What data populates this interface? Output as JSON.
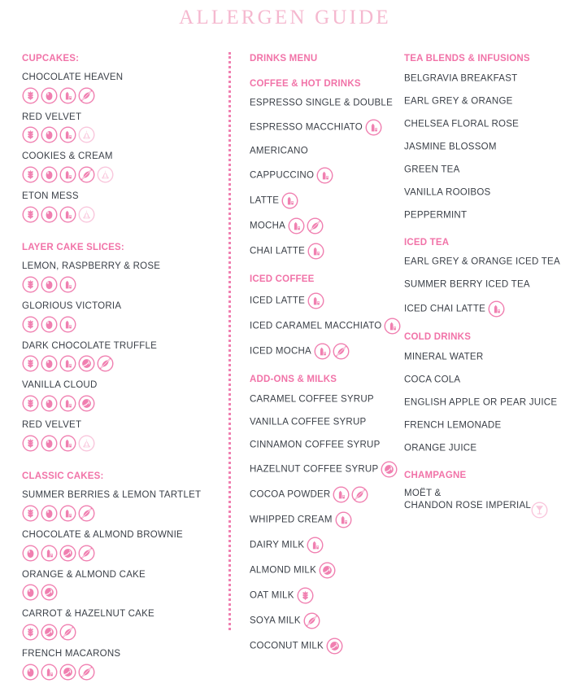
{
  "title": "ALLERGEN GUIDE",
  "colors": {
    "title_pink": "#f5b8cf",
    "heading_pink": "#f173a8",
    "icon_pink": "#f07fb0",
    "icon_pink_light": "#f9c6dc",
    "text_dark": "#3a3f47"
  },
  "icon_legend": {
    "gluten": "wheat-icon",
    "egg": "egg-icon",
    "milk": "milk-icon",
    "nuts": "nut-crossed-icon",
    "soya": "soya-icon",
    "tree_nut": "hazelnut-icon",
    "champagne": "champagne-glass-icon"
  },
  "columns": [
    {
      "id": "bakes",
      "sections": [
        {
          "heading": "CUPCAKES:",
          "layout": "stacked",
          "items": [
            {
              "name": "CHOCOLATE HEAVEN",
              "icons": [
                "gluten",
                "egg",
                "milk",
                "nuts"
              ]
            },
            {
              "name": "RED VELVET",
              "icons": [
                "gluten",
                "egg",
                "milk",
                "soya"
              ]
            },
            {
              "name": "COOKIES & CREAM",
              "icons": [
                "gluten",
                "egg",
                "milk",
                "nuts",
                "soya"
              ]
            },
            {
              "name": "ETON MESS",
              "icons": [
                "gluten",
                "egg",
                "milk",
                "soya"
              ]
            }
          ]
        },
        {
          "heading": "LAYER CAKE SLICES:",
          "layout": "stacked",
          "items": [
            {
              "name": "LEMON, RASPBERRY & ROSE",
              "icons": [
                "gluten",
                "egg",
                "milk"
              ]
            },
            {
              "name": "GLORIOUS VICTORIA",
              "icons": [
                "gluten",
                "egg",
                "milk"
              ]
            },
            {
              "name": "DARK CHOCOLATE TRUFFLE",
              "icons": [
                "gluten",
                "egg",
                "milk",
                "tree_nut",
                "nuts"
              ]
            },
            {
              "name": "VANILLA CLOUD",
              "icons": [
                "gluten",
                "egg",
                "milk",
                "tree_nut"
              ]
            },
            {
              "name": "RED VELVET",
              "icons": [
                "gluten",
                "egg",
                "milk",
                "soya"
              ]
            }
          ]
        },
        {
          "heading": "CLASSIC CAKES:",
          "layout": "stacked",
          "items": [
            {
              "name": "SUMMER BERRIES & LEMON TARTLET",
              "icons": [
                "gluten",
                "egg",
                "milk",
                "nuts"
              ]
            },
            {
              "name": "CHOCOLATE & ALMOND BROWNIE",
              "icons": [
                "egg",
                "milk",
                "tree_nut",
                "nuts"
              ]
            },
            {
              "name": "ORANGE & ALMOND CAKE",
              "icons": [
                "egg",
                "tree_nut"
              ]
            },
            {
              "name": "CARROT & HAZELNUT CAKE",
              "icons": [
                "gluten",
                "tree_nut",
                "nuts"
              ]
            },
            {
              "name": "FRENCH MACARONS",
              "icons": [
                "egg",
                "milk",
                "tree_nut",
                "nuts"
              ]
            }
          ]
        }
      ]
    },
    {
      "id": "drinks",
      "sections": [
        {
          "heading": "DRINKS MENU",
          "layout": "title-only",
          "items": []
        },
        {
          "heading": "COFFEE & HOT DRINKS",
          "layout": "inline",
          "items": [
            {
              "name": "ESPRESSO SINGLE & DOUBLE",
              "icons": []
            },
            {
              "name": "ESPRESSO MACCHIATO",
              "icons": [
                "milk"
              ]
            },
            {
              "name": "AMERICANO",
              "icons": []
            },
            {
              "name": "CAPPUCCINO",
              "icons": [
                "milk"
              ]
            },
            {
              "name": "LATTE",
              "icons": [
                "milk"
              ]
            },
            {
              "name": "MOCHA",
              "icons": [
                "milk",
                "nuts"
              ]
            },
            {
              "name": "CHAI LATTE",
              "icons": [
                "milk"
              ]
            }
          ]
        },
        {
          "heading": "ICED COFFEE",
          "layout": "inline",
          "items": [
            {
              "name": "ICED LATTE",
              "icons": [
                "milk"
              ]
            },
            {
              "name": "ICED CARAMEL MACCHIATO",
              "icons": [
                "milk"
              ]
            },
            {
              "name": "ICED MOCHA",
              "icons": [
                "milk",
                "nuts"
              ]
            }
          ]
        },
        {
          "heading": "ADD-ONS & MILKS",
          "layout": "inline",
          "items": [
            {
              "name": "CARAMEL COFFEE SYRUP",
              "icons": []
            },
            {
              "name": "VANILLA COFFEE SYRUP",
              "icons": []
            },
            {
              "name": "CINNAMON COFFEE SYRUP",
              "icons": []
            },
            {
              "name": "HAZELNUT COFFEE SYRUP",
              "icons": [
                "tree_nut"
              ]
            },
            {
              "name": "COCOA POWDER",
              "icons": [
                "milk",
                "nuts"
              ]
            },
            {
              "name": "WHIPPED CREAM",
              "icons": [
                "milk"
              ]
            },
            {
              "name": "DAIRY MILK",
              "icons": [
                "milk"
              ]
            },
            {
              "name": "ALMOND MILK",
              "icons": [
                "tree_nut"
              ]
            },
            {
              "name": "OAT MILK",
              "icons": [
                "gluten"
              ]
            },
            {
              "name": "SOYA MILK",
              "icons": [
                "nuts"
              ]
            },
            {
              "name": "COCONUT MILK",
              "icons": [
                "tree_nut"
              ]
            }
          ]
        }
      ]
    },
    {
      "id": "tea-cold",
      "sections": [
        {
          "heading": "TEA BLENDS & INFUSIONS",
          "layout": "inline",
          "items": [
            {
              "name": "BELGRAVIA BREAKFAST",
              "icons": []
            },
            {
              "name": "EARL GREY & ORANGE",
              "icons": []
            },
            {
              "name": "CHELSEA FLORAL ROSE",
              "icons": []
            },
            {
              "name": "JASMINE BLOSSOM",
              "icons": []
            },
            {
              "name": "GREEN TEA",
              "icons": []
            },
            {
              "name": "VANILLA ROOIBOS",
              "icons": []
            },
            {
              "name": "PEPPERMINT",
              "icons": []
            }
          ]
        },
        {
          "heading": "ICED TEA",
          "layout": "inline",
          "items": [
            {
              "name": "EARL GREY & ORANGE ICED TEA",
              "icons": []
            },
            {
              "name": "SUMMER BERRY ICED TEA",
              "icons": []
            },
            {
              "name": "ICED CHAI LATTE",
              "icons": [
                "milk"
              ]
            }
          ]
        },
        {
          "heading": "COLD DRINKS",
          "layout": "inline",
          "items": [
            {
              "name": "MINERAL WATER",
              "icons": []
            },
            {
              "name": "COCA COLA",
              "icons": []
            },
            {
              "name": "ENGLISH APPLE OR PEAR JUICE",
              "icons": []
            },
            {
              "name": "FRENCH LEMONADE",
              "icons": []
            },
            {
              "name": "ORANGE JUICE",
              "icons": []
            }
          ]
        },
        {
          "heading": "CHAMPAGNE",
          "layout": "twoline",
          "items": [
            {
              "name": "MOËT &",
              "name2": "CHANDON ROSE IMPERIAL",
              "icons": [
                "champagne"
              ]
            }
          ]
        }
      ]
    }
  ]
}
